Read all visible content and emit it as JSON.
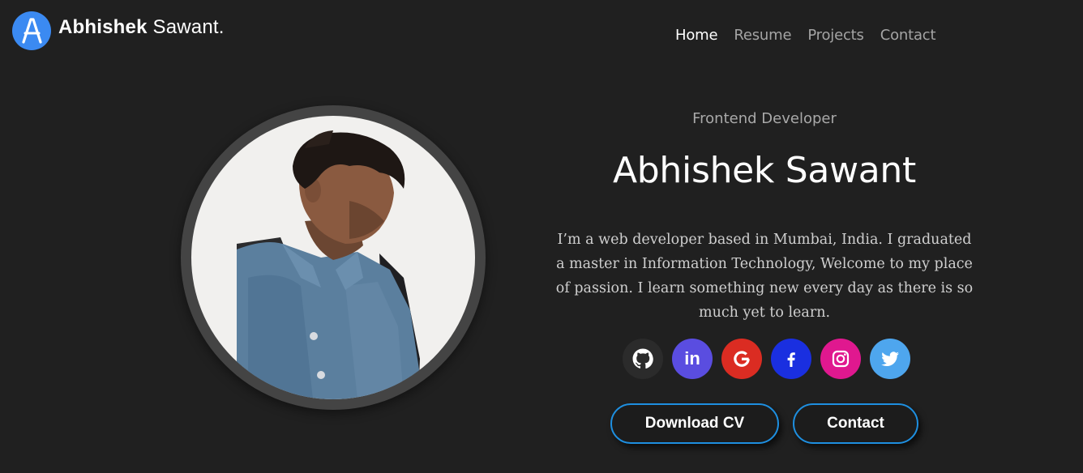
{
  "brand": {
    "logo_letter": "A",
    "first_name": "Abhishek",
    "last_name": " Sawant."
  },
  "nav": [
    {
      "label": "Home",
      "active": true
    },
    {
      "label": "Resume",
      "active": false
    },
    {
      "label": "Projects",
      "active": false
    },
    {
      "label": "Contact",
      "active": false
    }
  ],
  "hero": {
    "role": "Frontend Developer",
    "name": "Abhishek Sawant",
    "bio": "I’m a web developer based in Mumbai, India. I graduated a master in Information Technology, Welcome to my place of passion. I learn something new every day as there is so much yet to learn."
  },
  "socials": [
    {
      "icon": "github-icon",
      "color": "#2b2b2b"
    },
    {
      "icon": "linkedin-icon",
      "color": "#5a4de0",
      "text": "in"
    },
    {
      "icon": "google-icon",
      "color": "#db2c22"
    },
    {
      "icon": "facebook-icon",
      "color": "#1a2fe0"
    },
    {
      "icon": "instagram-icon",
      "color": "#e0188f"
    },
    {
      "icon": "twitter-icon",
      "color": "#4ea6ee"
    }
  ],
  "buttons": {
    "download_cv": "Download CV",
    "contact": "Contact"
  },
  "colors": {
    "background": "#202020",
    "accent": "#1e8fe0",
    "logo": "#3b8af2"
  }
}
